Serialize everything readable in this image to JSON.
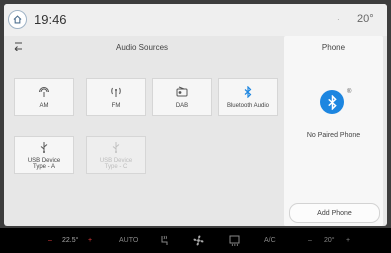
{
  "status_bar": {
    "time": "19:46",
    "status_icon_text": "·",
    "temperature": "20°"
  },
  "audio_sources": {
    "title": "Audio Sources",
    "sources": [
      {
        "label": "AM",
        "icon": "am-radio-icon",
        "enabled": true
      },
      {
        "label": "FM",
        "icon": "fm-radio-icon",
        "enabled": true
      },
      {
        "label": "DAB",
        "icon": "dab-radio-icon",
        "enabled": true
      },
      {
        "label": "Bluetooth Audio",
        "icon": "bluetooth-icon",
        "enabled": true
      },
      {
        "label": "USB Device\nType - A",
        "icon": "usb-icon",
        "enabled": true
      },
      {
        "label": "USB Device\nType - C",
        "icon": "usb-icon",
        "enabled": false
      }
    ]
  },
  "phone": {
    "title": "Phone",
    "status": "No Paired Phone",
    "add_button": "Add Phone",
    "accent_color": "#1d86e0"
  },
  "climate": {
    "driver_minus": "–",
    "driver_temp": "22.5°",
    "driver_plus": "+",
    "auto_label": "AUTO",
    "ac_label": "A/C",
    "passenger_minus": "–",
    "passenger_temp": "20°",
    "passenger_plus": "+"
  }
}
